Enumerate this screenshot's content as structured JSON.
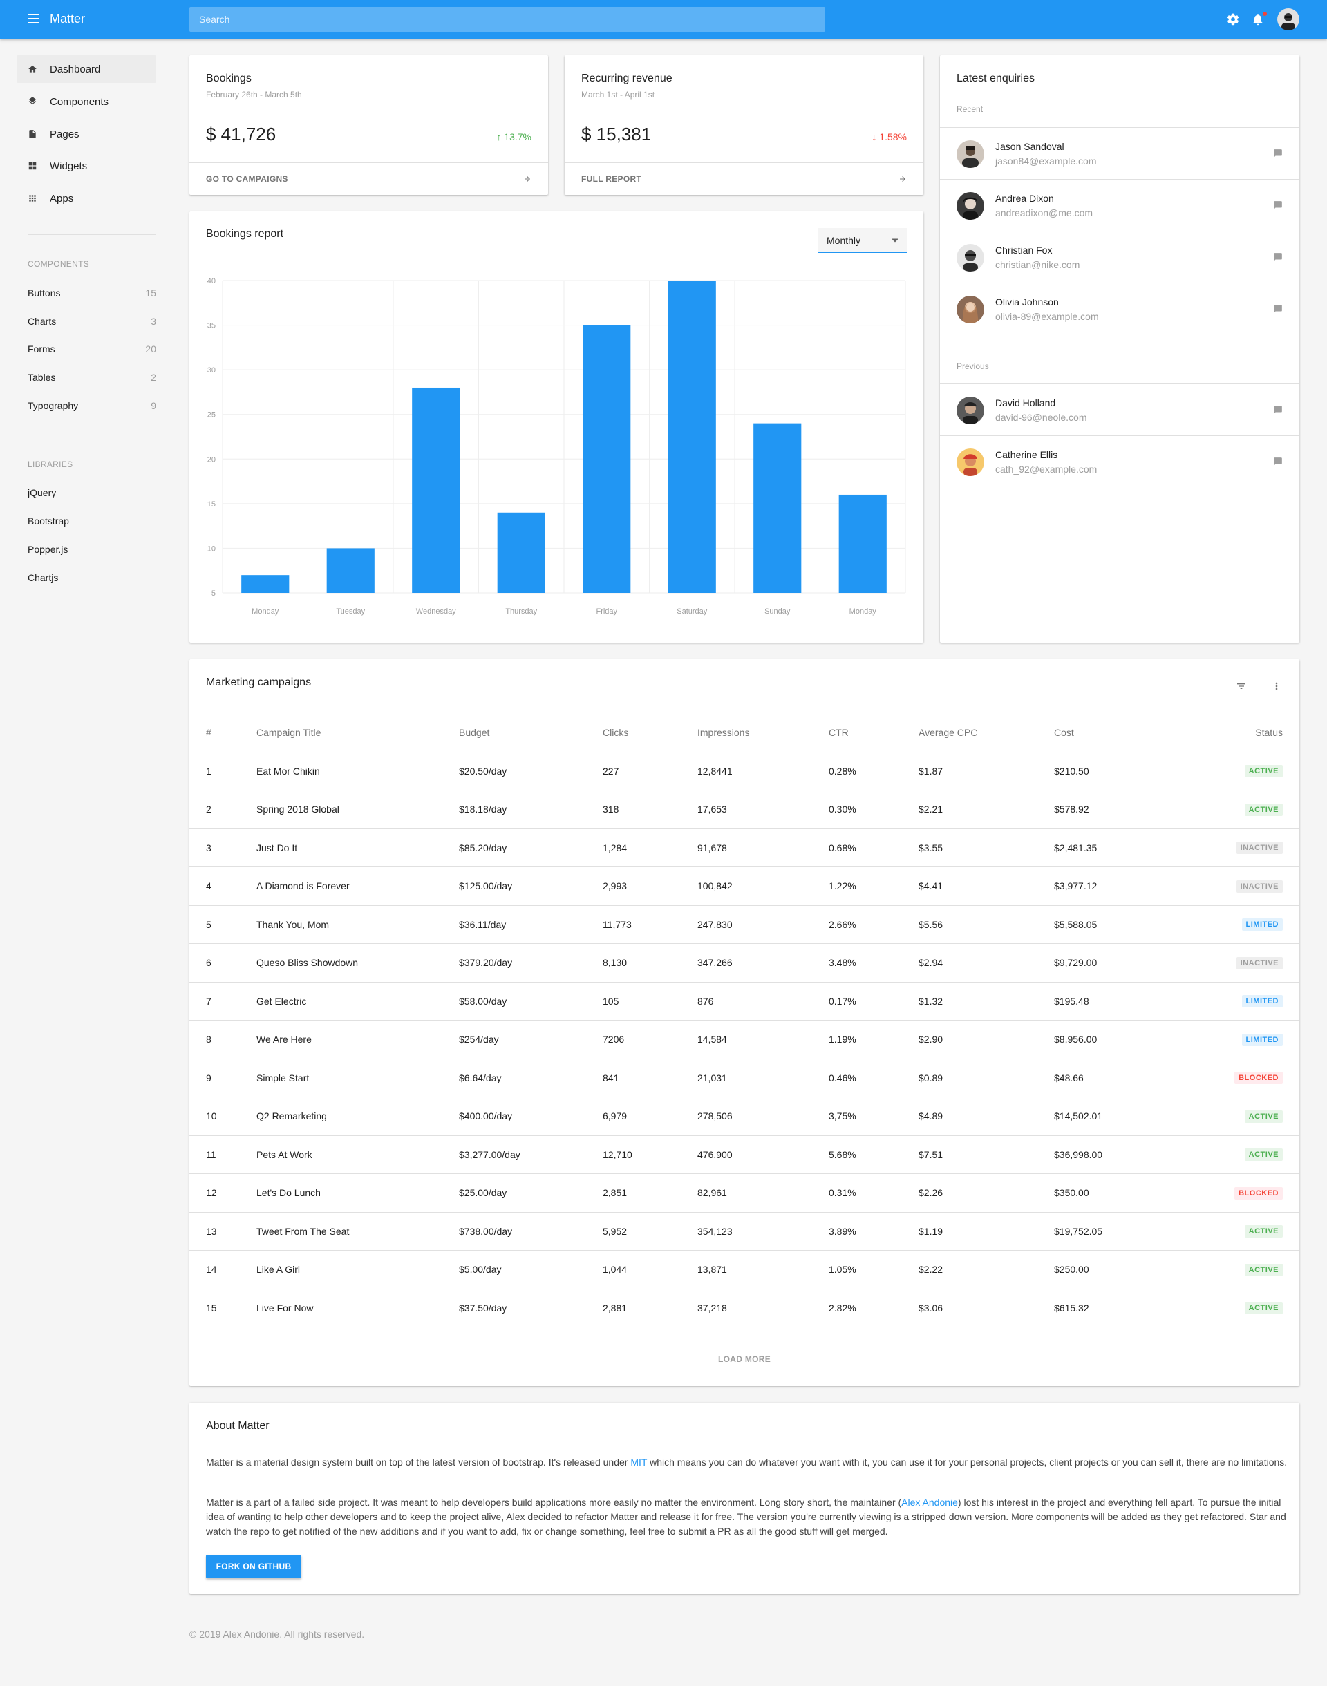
{
  "app": {
    "title": "Matter"
  },
  "search": {
    "placeholder": "Search"
  },
  "sidebar": {
    "nav": [
      {
        "label": "Dashboard",
        "icon": "home-icon"
      },
      {
        "label": "Components",
        "icon": "layers-icon"
      },
      {
        "label": "Pages",
        "icon": "page-icon"
      },
      {
        "label": "Widgets",
        "icon": "widgets-icon"
      },
      {
        "label": "Apps",
        "icon": "apps-grid-icon"
      }
    ],
    "components_heading": "COMPONENTS",
    "components": [
      {
        "label": "Buttons",
        "count": "15"
      },
      {
        "label": "Charts",
        "count": "3"
      },
      {
        "label": "Forms",
        "count": "20"
      },
      {
        "label": "Tables",
        "count": "2"
      },
      {
        "label": "Typography",
        "count": "9"
      }
    ],
    "libraries_heading": "LIBRARIES",
    "libraries": [
      "jQuery",
      "Bootstrap",
      "Popper.js",
      "Chartjs"
    ]
  },
  "bookings": {
    "title": "Bookings",
    "range": "February 26th - March 5th",
    "value": "$ 41,726",
    "delta": "13.7%",
    "footer": "GO TO CAMPAIGNS"
  },
  "revenue": {
    "title": "Recurring revenue",
    "range": "March 1st - April 1st",
    "value": "$ 15,381",
    "delta": "1.58%",
    "footer": "FULL REPORT"
  },
  "report": {
    "title": "Bookings report",
    "period": "Monthly"
  },
  "chart_data": {
    "type": "bar",
    "categories": [
      "Monday",
      "Tuesday",
      "Wednesday",
      "Thursday",
      "Friday",
      "Saturday",
      "Sunday",
      "Monday"
    ],
    "values": [
      7,
      10,
      28,
      14,
      35,
      40,
      24,
      16
    ],
    "ylim": [
      5,
      40
    ],
    "yticks": [
      5,
      10,
      15,
      20,
      25,
      30,
      35,
      40
    ],
    "grid": true,
    "color": "#2196f3",
    "title": "",
    "xlabel": "",
    "ylabel": ""
  },
  "enquiries": {
    "title": "Latest enquiries",
    "recent_heading": "Recent",
    "previous_heading": "Previous",
    "recent": [
      {
        "name": "Jason Sandoval",
        "email": "jason84@example.com"
      },
      {
        "name": "Andrea Dixon",
        "email": "andreadixon@me.com"
      },
      {
        "name": "Christian Fox",
        "email": "christian@nike.com"
      },
      {
        "name": "Olivia Johnson",
        "email": "olivia-89@example.com"
      }
    ],
    "previous": [
      {
        "name": "David Holland",
        "email": "david-96@neole.com"
      },
      {
        "name": "Catherine Ellis",
        "email": "cath_92@example.com"
      }
    ]
  },
  "campaigns": {
    "title": "Marketing campaigns",
    "columns": [
      "#",
      "Campaign Title",
      "Budget",
      "Clicks",
      "Impressions",
      "CTR",
      "Average CPC",
      "Cost",
      "Status"
    ],
    "rows": [
      [
        "1",
        "Eat Mor Chikin",
        "$20.50/day",
        "227",
        "12,8441",
        "0.28%",
        "$1.87",
        "$210.50",
        "ACTIVE"
      ],
      [
        "2",
        "Spring 2018 Global",
        "$18.18/day",
        "318",
        "17,653",
        "0.30%",
        "$2.21",
        "$578.92",
        "ACTIVE"
      ],
      [
        "3",
        "Just Do It",
        "$85.20/day",
        "1,284",
        "91,678",
        "0.68%",
        "$3.55",
        "$2,481.35",
        "INACTIVE"
      ],
      [
        "4",
        "A Diamond is Forever",
        "$125.00/day",
        "2,993",
        "100,842",
        "1.22%",
        "$4.41",
        "$3,977.12",
        "INACTIVE"
      ],
      [
        "5",
        "Thank You, Mom",
        "$36.11/day",
        "11,773",
        "247,830",
        "2.66%",
        "$5.56",
        "$5,588.05",
        "LIMITED"
      ],
      [
        "6",
        "Queso Bliss Showdown",
        "$379.20/day",
        "8,130",
        "347,266",
        "3.48%",
        "$2.94",
        "$9,729.00",
        "INACTIVE"
      ],
      [
        "7",
        "Get Electric",
        "$58.00/day",
        "105",
        "876",
        "0.17%",
        "$1.32",
        "$195.48",
        "LIMITED"
      ],
      [
        "8",
        "We Are Here",
        "$254/day",
        "7206",
        "14,584",
        "1.19%",
        "$2.90",
        "$8,956.00",
        "LIMITED"
      ],
      [
        "9",
        "Simple Start",
        "$6.64/day",
        "841",
        "21,031",
        "0.46%",
        "$0.89",
        "$48.66",
        "BLOCKED"
      ],
      [
        "10",
        "Q2 Remarketing",
        "$400.00/day",
        "6,979",
        "278,506",
        "3,75%",
        "$4.89",
        "$14,502.01",
        "ACTIVE"
      ],
      [
        "11",
        "Pets At Work",
        "$3,277.00/day",
        "12,710",
        "476,900",
        "5.68%",
        "$7.51",
        "$36,998.00",
        "ACTIVE"
      ],
      [
        "12",
        "Let's Do Lunch",
        "$25.00/day",
        "2,851",
        "82,961",
        "0.31%",
        "$2.26",
        "$350.00",
        "BLOCKED"
      ],
      [
        "13",
        "Tweet From The Seat",
        "$738.00/day",
        "5,952",
        "354,123",
        "3.89%",
        "$1.19",
        "$19,752.05",
        "ACTIVE"
      ],
      [
        "14",
        "Like A Girl",
        "$5.00/day",
        "1,044",
        "13,871",
        "1.05%",
        "$2.22",
        "$250.00",
        "ACTIVE"
      ],
      [
        "15",
        "Live For Now",
        "$37.50/day",
        "2,881",
        "37,218",
        "2.82%",
        "$3.06",
        "$615.32",
        "ACTIVE"
      ]
    ],
    "load_more": "LOAD MORE"
  },
  "about": {
    "title": "About Matter",
    "p1_before": "Matter is a material design system built on top of the latest version of bootstrap. It's released under ",
    "p1_link": "MIT",
    "p1_after": " which means you can do whatever you want with it, you can use it for your personal projects, client projects or you can sell it, there are no limitations.",
    "p2_before": "Matter is a part of a failed side project. It was meant to help developers build applications more easily no matter the environment. Long story short, the maintainer (",
    "p2_link": "Alex Andonie",
    "p2_after": ") lost his interest in the project and everything fell apart. To pursue the initial idea of wanting to help other developers and to keep the project alive, Alex decided to refactor Matter and release it for free. The version you're currently viewing is a stripped down version. More components will be added as they get refactored. Star and watch the repo to get notified of the new additions and if you want to add, fix or change something, feel free to submit a PR as all the good stuff will get merged.",
    "button": "FORK ON GITHUB"
  },
  "footer": "© 2019 Alex Andonie. All rights reserved."
}
